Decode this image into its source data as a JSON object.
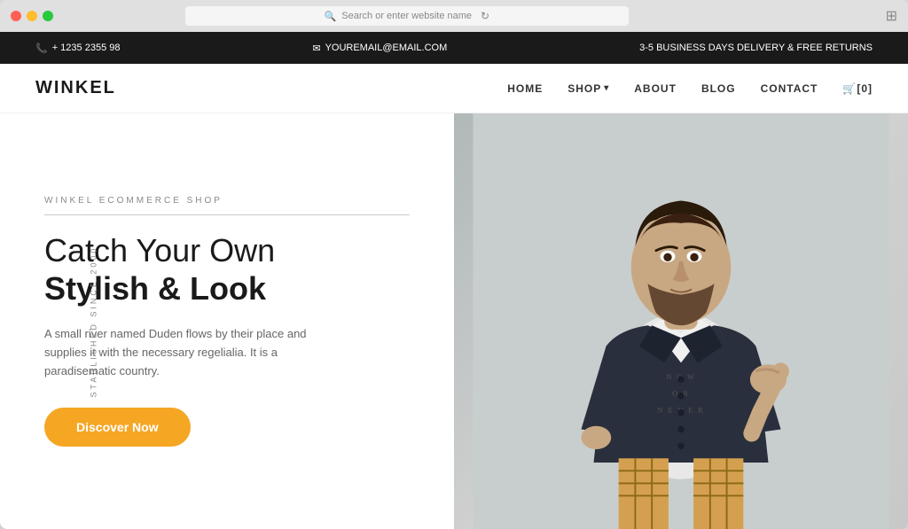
{
  "browser": {
    "address_placeholder": "Search or enter website name",
    "expand_icon": "⊞"
  },
  "topbar": {
    "phone_icon": "📞",
    "phone": "+ 1235 2355 98",
    "email_icon": "✉",
    "email": "YOUREMAIL@EMAIL.COM",
    "delivery": "3-5 BUSINESS DAYS DELIVERY & FREE RETURNS"
  },
  "nav": {
    "logo": "WINKEL",
    "links": [
      {
        "label": "HOME",
        "active": true
      },
      {
        "label": "SHOP",
        "dropdown": true
      },
      {
        "label": "ABOUT"
      },
      {
        "label": "BLOG"
      },
      {
        "label": "CONTACT"
      }
    ],
    "cart_label": "🛒[0]"
  },
  "hero": {
    "side_text": "STABLISHED SINCE 2000",
    "subtitle": "WINKEL ECOMMERCE SHOP",
    "title_light": "Catch Your Own",
    "title_bold": "Stylish & Look",
    "description": "A small river named Duden flows by their place and supplies it with the necessary regelialia. It is a paradisematic country.",
    "cta_label": "Discover Now"
  }
}
